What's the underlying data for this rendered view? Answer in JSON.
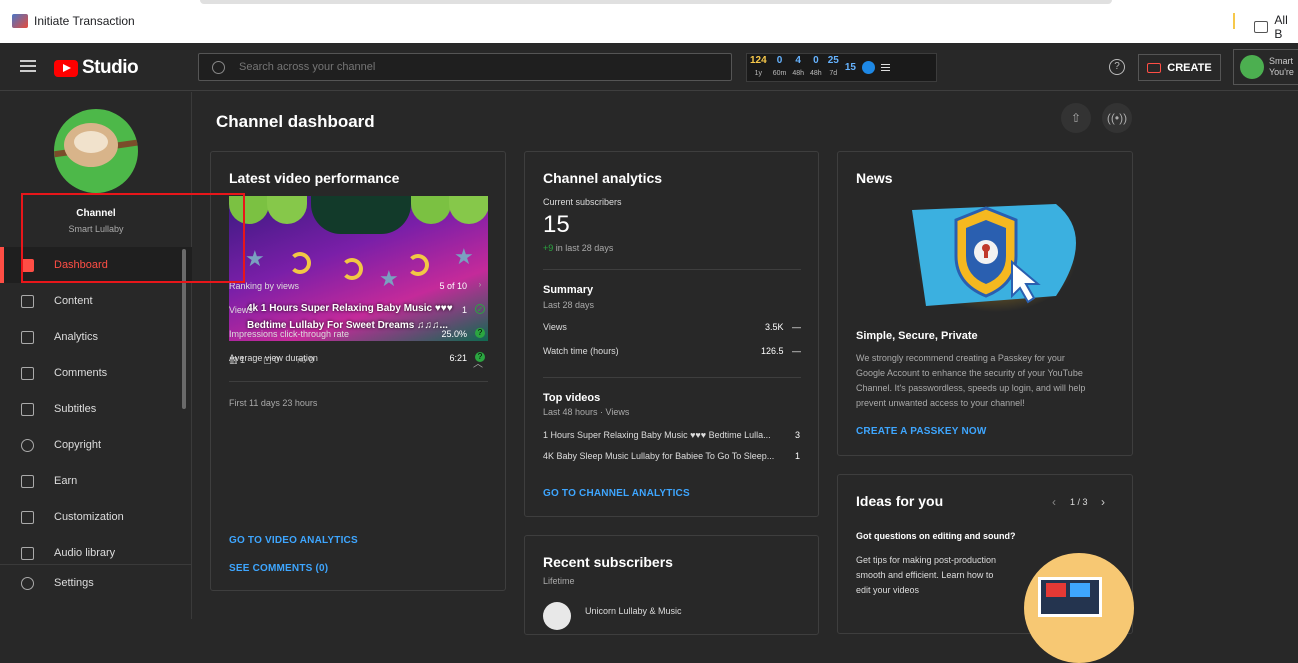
{
  "bookmarks": {
    "item1": "Initiate Transaction",
    "item2": "All B"
  },
  "topbar": {
    "studio": "Studio",
    "search_placeholder": "Search across your channel",
    "create": "CREATE",
    "help": "?",
    "account_name": "Smart",
    "account_sub": "You're",
    "stats": [
      {
        "value": "124",
        "label": "1y",
        "color": "#f7c84a"
      },
      {
        "value": "0",
        "label": "60m",
        "color": "#66b3ff"
      },
      {
        "value": "4",
        "label": "48h",
        "color": "#66b3ff"
      },
      {
        "value": "0",
        "label": "48h",
        "color": "#66b3ff"
      },
      {
        "value": "25",
        "label": "7d",
        "color": "#66b3ff"
      },
      {
        "value": "15",
        "label": "",
        "color": "#66b3ff"
      }
    ]
  },
  "sidebar": {
    "channel_label": "Channel",
    "channel_name": "Smart Lullaby",
    "items": [
      {
        "label": "Dashboard",
        "icon": "dashboard-icon"
      },
      {
        "label": "Content",
        "icon": "content-icon"
      },
      {
        "label": "Analytics",
        "icon": "analytics-icon"
      },
      {
        "label": "Comments",
        "icon": "comments-icon"
      },
      {
        "label": "Subtitles",
        "icon": "subtitles-icon"
      },
      {
        "label": "Copyright",
        "icon": "copyright-icon"
      },
      {
        "label": "Earn",
        "icon": "earn-icon"
      },
      {
        "label": "Customization",
        "icon": "customization-icon"
      },
      {
        "label": "Audio library",
        "icon": "audio-library-icon"
      }
    ],
    "settings": "Settings"
  },
  "main": {
    "title": "Channel dashboard",
    "latest": {
      "heading": "Latest video performance",
      "thumb_line1": "4k 1 Hours Super Relaxing Baby Music ♥♥♥",
      "thumb_line2": "Bedtime Lullaby For Sweet Dreams ♫♫♫...",
      "views_count": "1",
      "comments_count": "0",
      "likes_count": "0",
      "period": "First 11 days 23 hours",
      "rows": [
        {
          "label": "Ranking by views",
          "value": "5 of 10"
        },
        {
          "label": "Views",
          "value": "1"
        },
        {
          "label": "Impressions click-through rate",
          "value": "25.0%"
        },
        {
          "label": "Average view duration",
          "value": "6:21"
        }
      ],
      "link1": "GO TO VIDEO ANALYTICS",
      "link2": "SEE COMMENTS (0)"
    },
    "analytics": {
      "heading": "Channel analytics",
      "subs_label": "Current subscribers",
      "subs_value": "15",
      "subs_delta": "+9",
      "subs_delta_text": "in last 28 days",
      "summary": "Summary",
      "summary_sub": "Last 28 days",
      "views_label": "Views",
      "views_value": "3.5K",
      "watch_label": "Watch time (hours)",
      "watch_value": "126.5",
      "dash": "—",
      "top_videos": "Top videos",
      "top_sub": "Last 48 hours · Views",
      "top1": "1 Hours Super Relaxing Baby Music ♥♥♥ Bedtime Lulla...",
      "top1_val": "3",
      "top2": "4K Baby Sleep Music Lullaby for Babiee To Go To Sleep...",
      "top2_val": "1",
      "link": "GO TO CHANNEL ANALYTICS"
    },
    "recent": {
      "heading": "Recent subscribers",
      "sub": "Lifetime",
      "first": "Unicorn Lullaby & Music"
    },
    "news": {
      "heading": "News",
      "title": "Simple, Secure, Private",
      "body1": "We strongly recommend creating a Passkey for your",
      "body2": "Google Account to enhance the security of your YouTube",
      "body3": "Channel. It's passwordless, speeds up login, and will help",
      "body4": "prevent unwanted access to your channel!",
      "link": "CREATE A PASSKEY NOW"
    },
    "ideas": {
      "heading": "Ideas for you",
      "pager": "1 / 3",
      "q": "Got questions on editing and sound?",
      "body1": "Get tips for making post-production",
      "body2": "smooth and efficient. Learn how to",
      "body3": "edit your videos"
    }
  }
}
